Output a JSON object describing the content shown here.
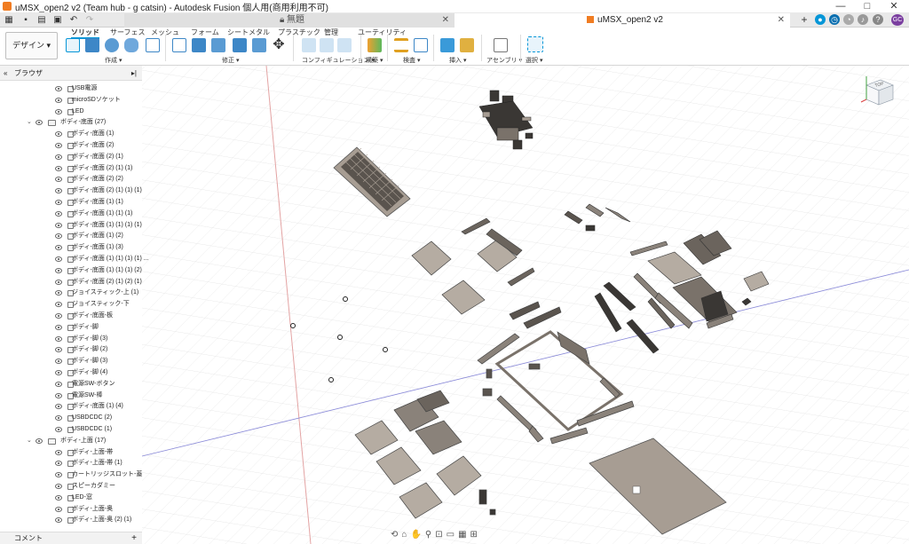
{
  "window": {
    "title": "uMSX_open2 v2 (Team hub - g catsin) - Autodesk Fusion 個人用(商用利用不可)",
    "minimize": "—",
    "maximize": "□",
    "close": "✕"
  },
  "tabs": [
    {
      "label": "無題"
    },
    {
      "label": "uMSX_open2 v2"
    }
  ],
  "tab_close": "✕",
  "tab_add": "+",
  "user_initials": "GC",
  "ribbon": {
    "design_button": "デザイン ▾",
    "tabs": [
      "ソリッド",
      "サーフェス",
      "メッシュ",
      "フォーム",
      "シートメタル",
      "プラスチック",
      "管理",
      "ユーティリティ"
    ],
    "groups": [
      "作成 ▾",
      "修正 ▾",
      "コンフィギュレーション ▾",
      "構築 ▾",
      "検査 ▾",
      "挿入 ▾",
      "アセンブリ ▾",
      "選択 ▾"
    ]
  },
  "browser": {
    "title": "ブラウザ",
    "rows": [
      {
        "label": "USB電源",
        "indent": 3,
        "type": "body"
      },
      {
        "label": "microSDソケット",
        "indent": 3,
        "type": "body"
      },
      {
        "label": "LED",
        "indent": 3,
        "type": "body"
      },
      {
        "label": "ボディ-底面 (27)",
        "indent": 2,
        "type": "folder"
      },
      {
        "label": "ボディ-底面 (1)",
        "indent": 3,
        "type": "body"
      },
      {
        "label": "ボディ-底面 (2)",
        "indent": 3,
        "type": "body"
      },
      {
        "label": "ボディ-底面 (2) (1)",
        "indent": 3,
        "type": "body"
      },
      {
        "label": "ボディ-底面 (2) (1) (1)",
        "indent": 3,
        "type": "body"
      },
      {
        "label": "ボディ-底面 (2) (2)",
        "indent": 3,
        "type": "body"
      },
      {
        "label": "ボディ-底面 (2) (1) (1) (1)",
        "indent": 3,
        "type": "body"
      },
      {
        "label": "ボディ-底面 (1) (1)",
        "indent": 3,
        "type": "body"
      },
      {
        "label": "ボディ-底面 (1) (1) (1)",
        "indent": 3,
        "type": "body"
      },
      {
        "label": "ボディ-底面 (1) (1) (1) (1)",
        "indent": 3,
        "type": "body"
      },
      {
        "label": "ボディ-底面 (1) (2)",
        "indent": 3,
        "type": "body"
      },
      {
        "label": "ボディ-底面 (1) (3)",
        "indent": 3,
        "type": "body"
      },
      {
        "label": "ボディ-底面 (1) (1) (1) (1) ...",
        "indent": 3,
        "type": "body"
      },
      {
        "label": "ボディ-底面 (1) (1) (1) (2)",
        "indent": 3,
        "type": "body"
      },
      {
        "label": "ボディ-底面 (2) (1) (2) (1)",
        "indent": 3,
        "type": "body"
      },
      {
        "label": "ジョイスティック-上 (1)",
        "indent": 3,
        "type": "body"
      },
      {
        "label": "ジョイスティック-下",
        "indent": 3,
        "type": "body"
      },
      {
        "label": "ボディ-底面-板",
        "indent": 3,
        "type": "body"
      },
      {
        "label": "ボディ-脚",
        "indent": 3,
        "type": "body"
      },
      {
        "label": "ボディ-脚 (3)",
        "indent": 3,
        "type": "body"
      },
      {
        "label": "ボディ-脚 (2)",
        "indent": 3,
        "type": "body"
      },
      {
        "label": "ボディ-脚 (3)",
        "indent": 3,
        "type": "body"
      },
      {
        "label": "ボディ-脚 (4)",
        "indent": 3,
        "type": "body"
      },
      {
        "label": "電源SW-ボタン",
        "indent": 3,
        "type": "body"
      },
      {
        "label": "電源SW-棒",
        "indent": 3,
        "type": "body"
      },
      {
        "label": "ボディ-底面 (1) (4)",
        "indent": 3,
        "type": "body"
      },
      {
        "label": "USBDCDC (2)",
        "indent": 3,
        "type": "body"
      },
      {
        "label": "USBDCDC (1)",
        "indent": 3,
        "type": "body"
      },
      {
        "label": "ボディ-上面 (17)",
        "indent": 2,
        "type": "folder"
      },
      {
        "label": "ボディ-上面-帯",
        "indent": 3,
        "type": "body"
      },
      {
        "label": "ボディ-上面-帯 (1)",
        "indent": 3,
        "type": "body"
      },
      {
        "label": "カートリッジスロット-蓋",
        "indent": 3,
        "type": "body"
      },
      {
        "label": "スピーカダミー",
        "indent": 3,
        "type": "body"
      },
      {
        "label": "LED-窓",
        "indent": 3,
        "type": "body"
      },
      {
        "label": "ボディ-上面-奥",
        "indent": 3,
        "type": "body"
      },
      {
        "label": "ボディ-上面-奥 (2) (1)",
        "indent": 3,
        "type": "body"
      }
    ]
  },
  "comments": {
    "title": "コメント",
    "add": "+"
  },
  "viewcube": {
    "face": "TOP"
  },
  "colors": {
    "accent": "#0696d7",
    "part_fill": "#a79d93",
    "part_dark": "#3a3734",
    "grid": "#dcdcdc",
    "user_avatar": "#7b3fa0"
  }
}
